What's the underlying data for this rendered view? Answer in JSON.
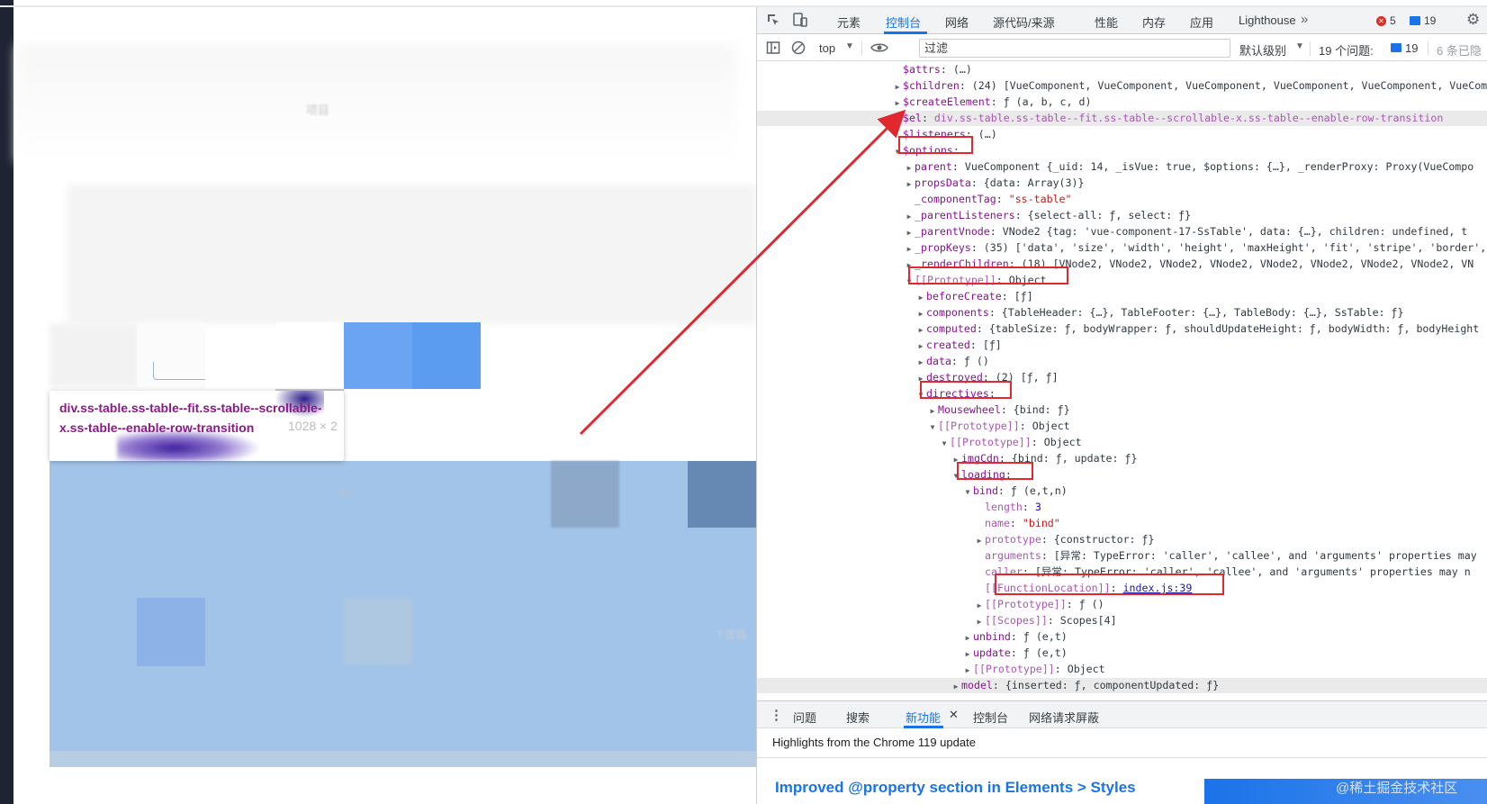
{
  "page": {
    "tooltip_selector": "div.ss-table.ss-table--fit.ss-table--scrollable-x.ss-table--enable-row-transition",
    "tooltip_size": "1028 × 2",
    "ghost_texts": [
      "如",
      "--",
      "--",
      "T货商",
      "项目"
    ]
  },
  "devtools": {
    "tabs": [
      "元素",
      "控制台",
      "网络",
      "源代码/来源",
      "性能",
      "内存",
      "应用",
      "Lighthouse"
    ],
    "active_tab": "控制台",
    "more_tabs_icon": "chevrons-right-icon",
    "errors_count": "5",
    "messages_count": "19",
    "toolbar": {
      "context": "top",
      "filter_placeholder": "过滤",
      "levels": "默认级别",
      "issues_label": "19 个问题:",
      "issues_count": "19",
      "hidden_label": "6 条已隐"
    },
    "tree": [
      {
        "indent": 0,
        "tri": "",
        "key": "$attrs",
        "value": "(…)"
      },
      {
        "indent": 0,
        "tri": "▶",
        "key": "$children",
        "value": "(24) [VueComponent, VueComponent, VueComponent, VueComponent, VueComponent, VueComponent"
      },
      {
        "indent": 0,
        "tri": "▶",
        "key": "$createElement",
        "value": "ƒ (a, b, c, d)"
      },
      {
        "indent": 0,
        "tri": "▶",
        "key": "$el",
        "value": "div.ss-table.ss-table--fit.ss-table--scrollable-x.ss-table--enable-row-transition",
        "highlight": true
      },
      {
        "indent": 0,
        "tri": "",
        "key": "$listeners",
        "value": "(…)"
      },
      {
        "indent": 0,
        "tri": "▼",
        "key": "$options",
        "value": ""
      },
      {
        "indent": 1,
        "tri": "▶",
        "key": "parent",
        "value": "VueComponent {_uid: 14, _isVue: true, $options: {…}, _renderProxy: Proxy(VueCompo"
      },
      {
        "indent": 1,
        "tri": "▶",
        "key": "propsData",
        "value": "{data: Array(3)}"
      },
      {
        "indent": 1,
        "tri": "",
        "key": "_componentTag",
        "value": "\"ss-table\""
      },
      {
        "indent": 1,
        "tri": "▶",
        "key": "_parentListeners",
        "value": "{select-all: ƒ, select: ƒ}"
      },
      {
        "indent": 1,
        "tri": "▶",
        "key": "_parentVnode",
        "value": "VNode2 {tag: 'vue-component-17-SsTable', data: {…}, children: undefined, t"
      },
      {
        "indent": 1,
        "tri": "▶",
        "key": "_propKeys",
        "value": "(35) ['data', 'size', 'width', 'height', 'maxHeight', 'fit', 'stripe', 'border',"
      },
      {
        "indent": 1,
        "tri": "▶",
        "key": "_renderChildren",
        "value": "(18) [VNode2, VNode2, VNode2, VNode2, VNode2, VNode2, VNode2, VNode2, VN"
      },
      {
        "indent": 1,
        "tri": "▼",
        "key": "[[Prototype]]",
        "value": "Object",
        "dim": true
      },
      {
        "indent": 2,
        "tri": "▶",
        "key": "beforeCreate",
        "value": "[ƒ]"
      },
      {
        "indent": 2,
        "tri": "▶",
        "key": "components",
        "value": "{TableHeader: {…}, TableFooter: {…}, TableBody: {…}, SsTable: ƒ}"
      },
      {
        "indent": 2,
        "tri": "▶",
        "key": "computed",
        "value": "{tableSize: ƒ, bodyWrapper: ƒ, shouldUpdateHeight: ƒ, bodyWidth: ƒ, bodyHeight"
      },
      {
        "indent": 2,
        "tri": "▶",
        "key": "created",
        "value": "[ƒ]"
      },
      {
        "indent": 2,
        "tri": "▶",
        "key": "data",
        "value": "ƒ ()"
      },
      {
        "indent": 2,
        "tri": "▶",
        "key": "destroyed",
        "value": "(2) [ƒ, ƒ]"
      },
      {
        "indent": 2,
        "tri": "▼",
        "key": "directives",
        "value": ""
      },
      {
        "indent": 3,
        "tri": "▶",
        "key": "Mousewheel",
        "value": "{bind: ƒ}"
      },
      {
        "indent": 3,
        "tri": "▼",
        "key": "[[Prototype]]",
        "value": "Object",
        "dim": true
      },
      {
        "indent": 4,
        "tri": "▼",
        "key": "[[Prototype]]",
        "value": "Object",
        "dim": true
      },
      {
        "indent": 5,
        "tri": "▶",
        "key": "imgCdn",
        "value": "{bind: ƒ, update: ƒ}"
      },
      {
        "indent": 5,
        "tri": "▼",
        "key": "loading",
        "value": ""
      },
      {
        "indent": 6,
        "tri": "▼",
        "key": "bind",
        "value": "ƒ (e,t,n)"
      },
      {
        "indent": 7,
        "tri": "",
        "key": "length",
        "value": "3",
        "dim": true
      },
      {
        "indent": 7,
        "tri": "",
        "key": "name",
        "value": "\"bind\"",
        "dim": true
      },
      {
        "indent": 7,
        "tri": "▶",
        "key": "prototype",
        "value": "{constructor: ƒ}",
        "dim": true
      },
      {
        "indent": 7,
        "tri": "",
        "key": "arguments",
        "value": "[异常: TypeError: 'caller', 'callee', and 'arguments' properties may",
        "dim": true
      },
      {
        "indent": 7,
        "tri": "",
        "key": "caller",
        "value": "[异常: TypeError: 'caller', 'callee', and 'arguments' properties may n",
        "dim": true
      },
      {
        "indent": 7,
        "tri": "",
        "key": "[[FunctionLocation]]",
        "value": "index.js:39",
        "dim": true,
        "link": true
      },
      {
        "indent": 7,
        "tri": "▶",
        "key": "[[Prototype]]",
        "value": "ƒ ()",
        "dim": true
      },
      {
        "indent": 7,
        "tri": "▶",
        "key": "[[Scopes]]",
        "value": "Scopes[4]",
        "dim": true
      },
      {
        "indent": 6,
        "tri": "▶",
        "key": "unbind",
        "value": "ƒ (e,t)"
      },
      {
        "indent": 6,
        "tri": "▶",
        "key": "update",
        "value": "ƒ (e,t)"
      },
      {
        "indent": 6,
        "tri": "▶",
        "key": "[[Prototype]]",
        "value": "Object",
        "dim": true
      },
      {
        "indent": 5,
        "tri": "▶",
        "key": "model",
        "value": "{inserted: ƒ, componentUpdated: ƒ}",
        "highlight": true
      }
    ],
    "drawer": {
      "tabs": [
        "问题",
        "搜索",
        "新功能",
        "控制台",
        "网络请求屏蔽"
      ],
      "active_tab": "新功能",
      "close_icon": "close-icon",
      "highlights": "Highlights from the Chrome 119 update",
      "feature_title": "Improved @property section in Elements > Styles"
    }
  },
  "watermark": "@稀土掘金技术社区",
  "colors": {
    "accent": "#1a73e8",
    "annotation_red": "#e0282e",
    "property_key": "#881391",
    "string_value": "#c41a16",
    "number_value": "#1c00cf",
    "tooltip_text": "#8b1a86",
    "overlay_blue": "#a2c4e8"
  }
}
